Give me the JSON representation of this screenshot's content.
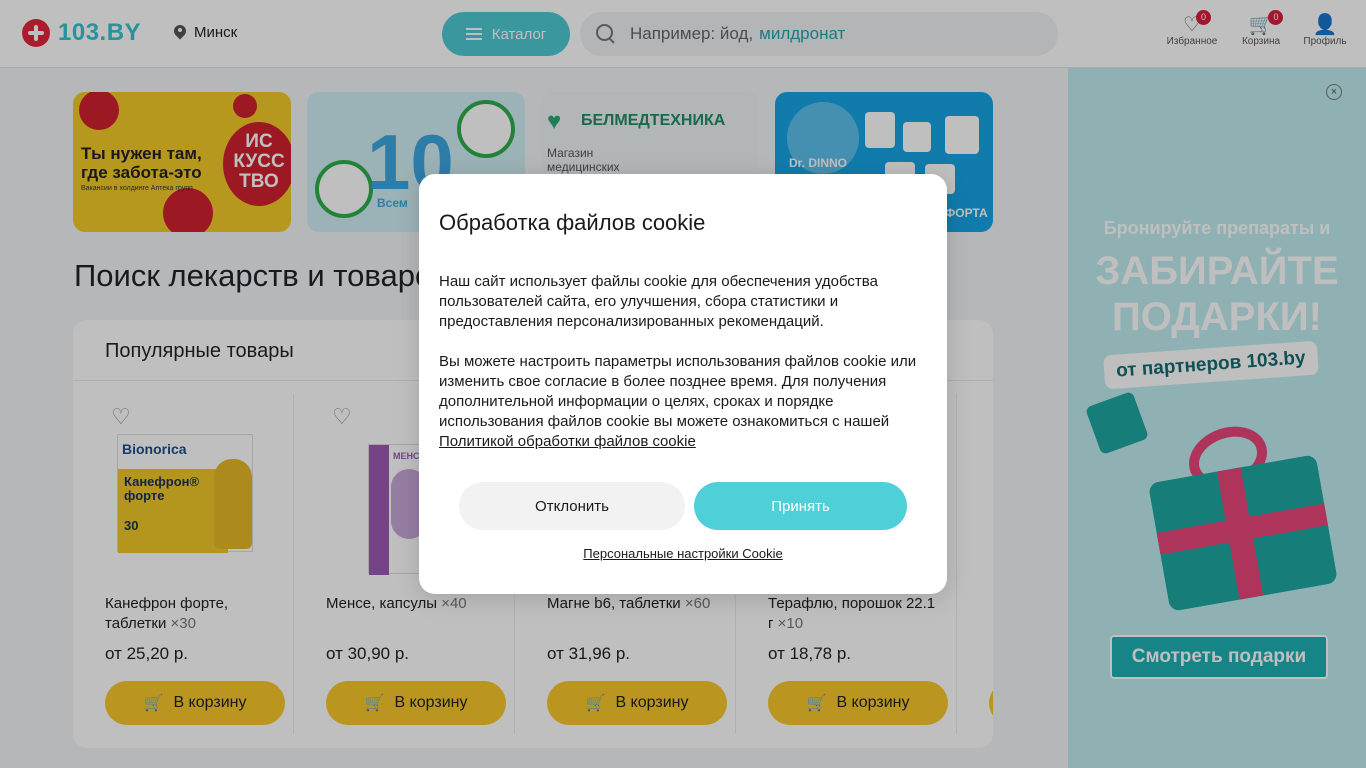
{
  "header": {
    "logo_text": "103.BY",
    "city": "Минск",
    "catalog_label": "Каталог",
    "search_placeholder": "Например: йод,",
    "search_hint": "милдронат",
    "favorites_label": "Избранное",
    "favorites_count": "0",
    "cart_label": "Корзина",
    "cart_count": "0",
    "profile_label": "Профиль"
  },
  "banners": {
    "b1_text": "Ты нужен там, где забота-это",
    "b1_small": "Вакансии в холдинге Аптека групп",
    "b1_art": "ИС КУСС ТВО",
    "b2_number": "10",
    "b2_text": "Всем",
    "b3_title": "БЕЛМЕДТЕХНИКА",
    "b3_text": "Магазин медицинских",
    "b4_brand": "Dr. DINNO",
    "b4_forte": "ФОРТА"
  },
  "main": {
    "heading": "Поиск лекарств и товаров"
  },
  "popular": {
    "title": "Популярные товары",
    "products": [
      {
        "name": "Канефрон форте, таблетки",
        "count": "×30",
        "price": "от 25,20 р.",
        "cart_label": "В корзину",
        "pack_brand": "Bionorica",
        "pack_name": "Канефрон® форте",
        "pack_qty": "30"
      },
      {
        "name": "Менсе, капсулы",
        "count": "×40",
        "price": "от 30,90 р.",
        "cart_label": "В корзину",
        "pack_brand": "МЕНСЕ"
      },
      {
        "name": "Магне b6, таблетки",
        "count": "×60",
        "price": "от 31,96 р.",
        "cart_label": "В корзину"
      },
      {
        "name": "Терафлю, порошок 22.1 г",
        "count": "×10",
        "price": "от 18,78 р.",
        "cart_label": "В корзину"
      }
    ]
  },
  "ad": {
    "line1": "Бронируйте препараты и",
    "line2": "ЗАБИРАЙТЕ ПОДАРКИ!",
    "line3": "от партнеров 103.by",
    "cta": "Смотреть подарки"
  },
  "cookie": {
    "title": "Обработка файлов cookie",
    "para1": "Наш сайт использует файлы cookie для обеспечения удобства пользователей сайта, его улучшения, сбора статистики и предоставления персонализированных рекомендаций.",
    "para2": "Вы можете настроить параметры использования файлов cookie или изменить свое согласие в более позднее время. Для получения дополнительной информации о целях, сроках и порядке использования файлов cookie вы можете ознакомиться с нашей",
    "policy_link": "Политикой обработки файлов cookie",
    "decline": "Отклонить",
    "accept": "Принять",
    "settings": "Персональные настройки Cookie"
  }
}
